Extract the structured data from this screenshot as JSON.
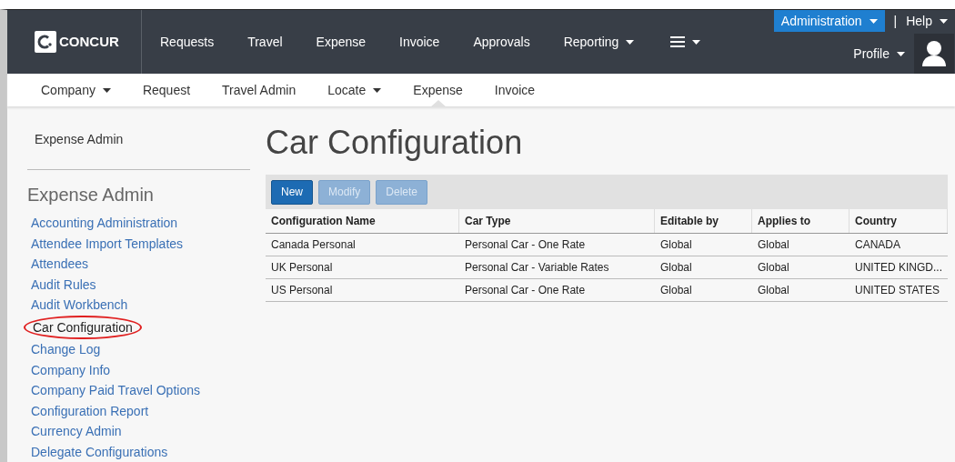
{
  "top_nav": {
    "logo": "CONCUR",
    "items": [
      {
        "label": "Requests",
        "dropdown": false
      },
      {
        "label": "Travel",
        "dropdown": false
      },
      {
        "label": "Expense",
        "dropdown": false
      },
      {
        "label": "Invoice",
        "dropdown": false
      },
      {
        "label": "Approvals",
        "dropdown": false
      },
      {
        "label": "Reporting",
        "dropdown": true
      }
    ],
    "administration": "Administration",
    "separator": "|",
    "help": "Help",
    "profile": "Profile"
  },
  "sub_nav": [
    {
      "label": "Company",
      "dropdown": true,
      "selected": false
    },
    {
      "label": "Request",
      "dropdown": false,
      "selected": false
    },
    {
      "label": "Travel Admin",
      "dropdown": false,
      "selected": false
    },
    {
      "label": "Locate",
      "dropdown": true,
      "selected": false
    },
    {
      "label": "Expense",
      "dropdown": false,
      "selected": true
    },
    {
      "label": "Invoice",
      "dropdown": false,
      "selected": false
    }
  ],
  "sidebar": {
    "breadcrumb": "Expense Admin",
    "heading": "Expense Admin",
    "items": [
      {
        "label": "Accounting Administration",
        "selected": false
      },
      {
        "label": "Attendee Import Templates",
        "selected": false
      },
      {
        "label": "Attendees",
        "selected": false
      },
      {
        "label": "Audit Rules",
        "selected": false
      },
      {
        "label": "Audit Workbench",
        "selected": false
      },
      {
        "label": "Car Configuration",
        "selected": true
      },
      {
        "label": "Change Log",
        "selected": false
      },
      {
        "label": "Company Info",
        "selected": false
      },
      {
        "label": "Company Paid Travel Options",
        "selected": false
      },
      {
        "label": "Configuration Report",
        "selected": false
      },
      {
        "label": "Currency Admin",
        "selected": false
      },
      {
        "label": "Delegate Configurations",
        "selected": false
      }
    ]
  },
  "page_title": "Car Configuration",
  "toolbar": [
    {
      "label": "New",
      "disabled": false
    },
    {
      "label": "Modify",
      "disabled": true
    },
    {
      "label": "Delete",
      "disabled": true
    }
  ],
  "table": {
    "columns": [
      "Configuration Name",
      "Car Type",
      "Editable by",
      "Applies to",
      "Country"
    ],
    "rows": [
      [
        "Canada Personal",
        "Personal Car - One Rate",
        "Global",
        "Global",
        "CANADA"
      ],
      [
        "UK Personal",
        "Personal Car - Variable Rates",
        "Global",
        "Global",
        "UNITED KINGD..."
      ],
      [
        "US Personal",
        "Personal Car - One Rate",
        "Global",
        "Global",
        "UNITED STATES"
      ]
    ]
  }
}
